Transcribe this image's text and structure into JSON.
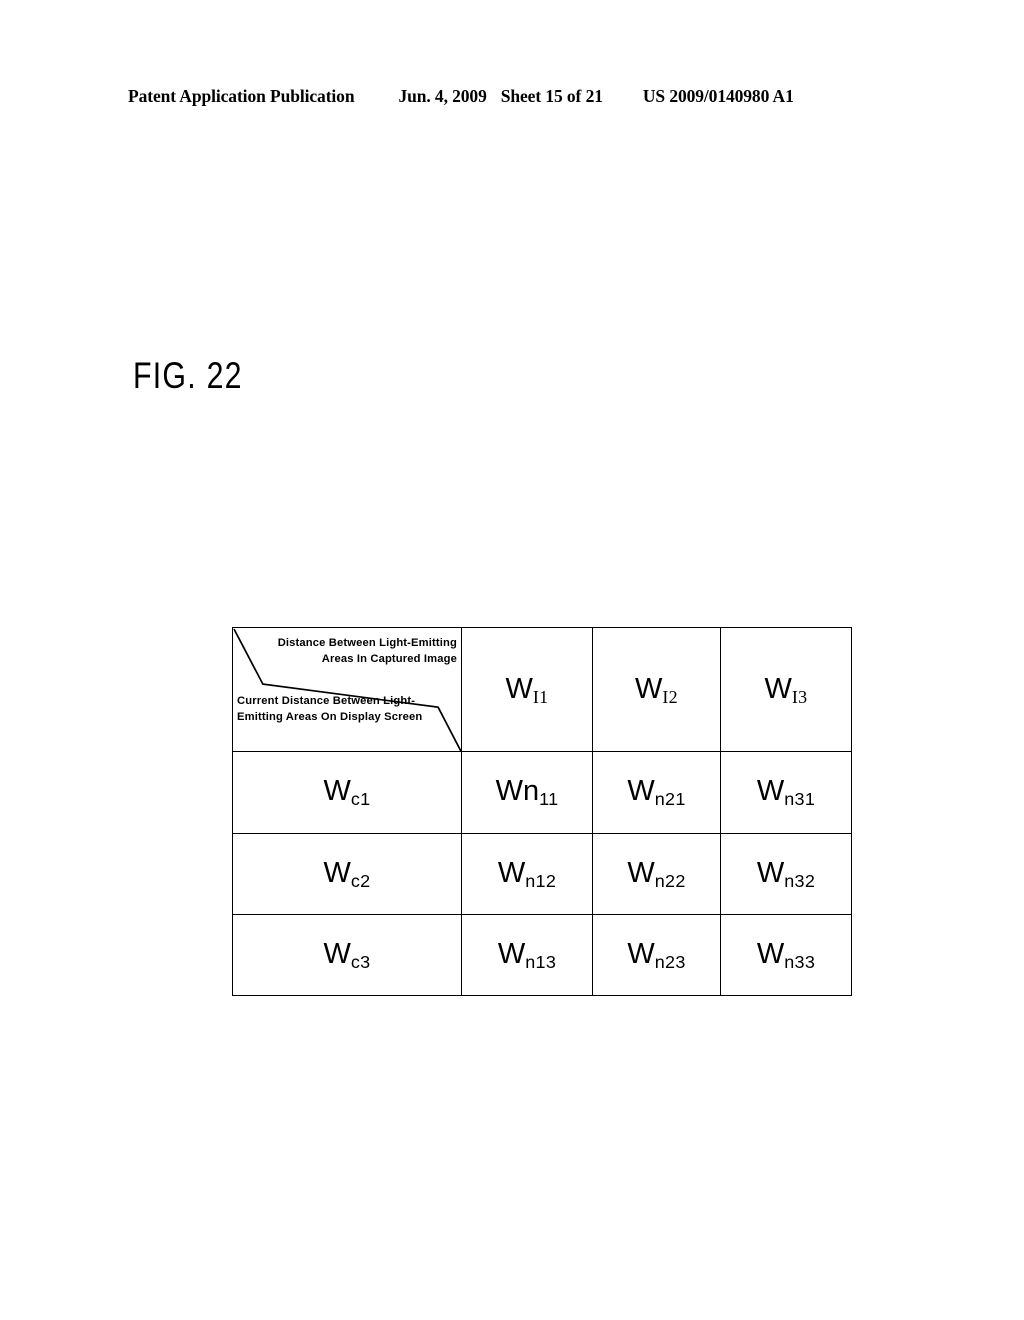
{
  "header": {
    "publication": "Patent Application Publication",
    "date": "Jun. 4, 2009",
    "sheet": "Sheet 15 of 21",
    "document_number": "US 2009/0140980 A1"
  },
  "figure": {
    "label": "FIG. 22"
  },
  "table": {
    "corner": {
      "upper_label_line1": "Distance Between Light-Emitting",
      "upper_label_line2": "Areas In Captured Image",
      "lower_label_line1": "Current Distance Between Light-",
      "lower_label_line2": "Emitting Areas On Display Screen"
    },
    "column_headers": [
      {
        "base": "W",
        "sub": "I1"
      },
      {
        "base": "W",
        "sub": "I2"
      },
      {
        "base": "W",
        "sub": "I3"
      }
    ],
    "rows": [
      {
        "label": {
          "base": "W",
          "sub": "c1"
        },
        "cells": [
          {
            "base": "Wn",
            "sub": "11"
          },
          {
            "base": "W",
            "sub": "n21"
          },
          {
            "base": "W",
            "sub": "n31"
          }
        ]
      },
      {
        "label": {
          "base": "W",
          "sub": "c2"
        },
        "cells": [
          {
            "base": "W",
            "sub": "n12"
          },
          {
            "base": "W",
            "sub": "n22"
          },
          {
            "base": "W",
            "sub": "n32"
          }
        ]
      },
      {
        "label": {
          "base": "W",
          "sub": "c3"
        },
        "cells": [
          {
            "base": "W",
            "sub": "n13"
          },
          {
            "base": "W",
            "sub": "n23"
          },
          {
            "base": "W",
            "sub": "n33"
          }
        ]
      }
    ]
  },
  "colors": {
    "ink": "#000000",
    "paper": "#ffffff"
  }
}
